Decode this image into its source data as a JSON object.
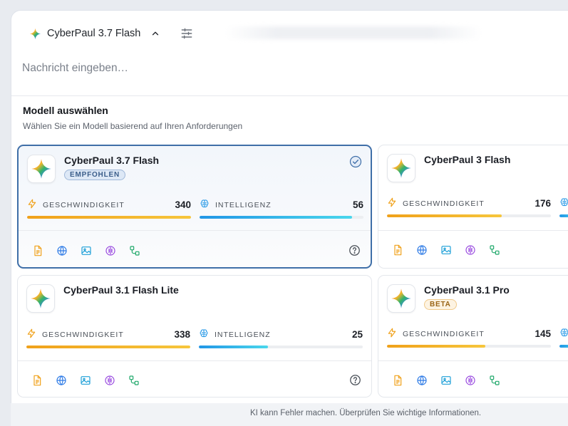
{
  "composer": {
    "model_name": "CyberPaul 3.7 Flash",
    "placeholder": "Nachricht eingeben…"
  },
  "picker": {
    "title": "Modell auswählen",
    "subtitle": "Wählen Sie ein Modell basierend auf Ihren Anforderungen"
  },
  "labels": {
    "speed": "GESCHWINDIGKEIT",
    "intel": "INTELLIGENZ"
  },
  "models": [
    {
      "name": "CyberPaul 3.7 Flash",
      "badge": "EMPFOHLEN",
      "speed": "340",
      "intel": "56",
      "speed_fill": 1.0,
      "intel_fill": 0.93,
      "selected": true
    },
    {
      "name": "CyberPaul 3 Flash",
      "badge": "",
      "speed": "176",
      "speed_fill": 0.7,
      "selected": false
    },
    {
      "name": "CyberPaul 3.1 Flash Lite",
      "badge": "",
      "speed": "338",
      "intel": "25",
      "speed_fill": 1.0,
      "intel_fill": 0.42,
      "selected": false
    },
    {
      "name": "CyberPaul 3.1 Pro",
      "badge": "BETA",
      "speed": "145",
      "speed_fill": 0.6,
      "selected": false
    }
  ],
  "footer": {
    "note": "KI kann Fehler machen. Überprüfen Sie wichtige Informationen."
  },
  "colors": {
    "accent": "#3f6fa8",
    "speed": "#f0a11a",
    "intel": "#2196e6"
  },
  "icons": [
    "sparkle-icon",
    "chevron-up-icon",
    "sliders-icon",
    "check-circle-icon",
    "bolt-icon",
    "brain-icon",
    "document-icon",
    "globe-icon",
    "image-icon",
    "reasoning-icon",
    "workflow-icon",
    "help-icon"
  ]
}
